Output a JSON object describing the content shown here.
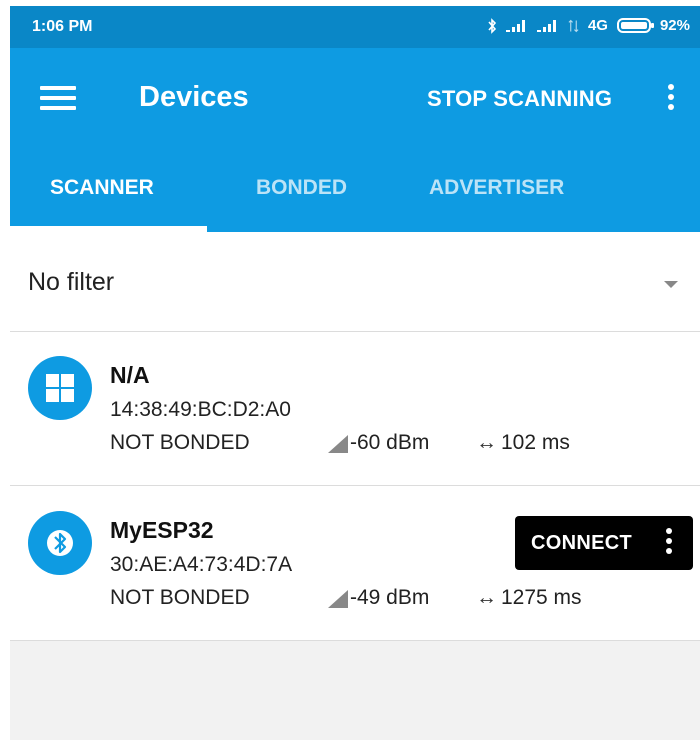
{
  "status_bar": {
    "time": "1:06 PM",
    "network": "4G",
    "battery": "92%",
    "icons": [
      "bluetooth-icon",
      "signal-icon",
      "signal-icon",
      "data-arrows-icon",
      "battery-icon"
    ]
  },
  "app_bar": {
    "title": "Devices",
    "stop_scanning_label": "STOP SCANNING",
    "icons": [
      "menu-icon",
      "more-vert-icon"
    ],
    "color": "#0e9be2"
  },
  "tabs": [
    {
      "label": "SCANNER",
      "active": true
    },
    {
      "label": "BONDED",
      "active": false
    },
    {
      "label": "ADVERTISER",
      "active": false
    }
  ],
  "filter": {
    "label": "No filter",
    "icon": "dropdown-arrow-icon"
  },
  "devices": [
    {
      "name": "N/A",
      "address": "14:38:49:BC:D2:A0",
      "bond_state": "NOT BONDED",
      "rssi": "-60 dBm",
      "interval": "102 ms",
      "icon": "windows-icon"
    },
    {
      "name": "MyESP32",
      "address": "30:AE:A4:73:4D:7A",
      "bond_state": "NOT BONDED",
      "rssi": "-49 dBm",
      "interval": "1275 ms",
      "icon": "bluetooth-icon",
      "connect_label": "CONNECT"
    }
  ]
}
